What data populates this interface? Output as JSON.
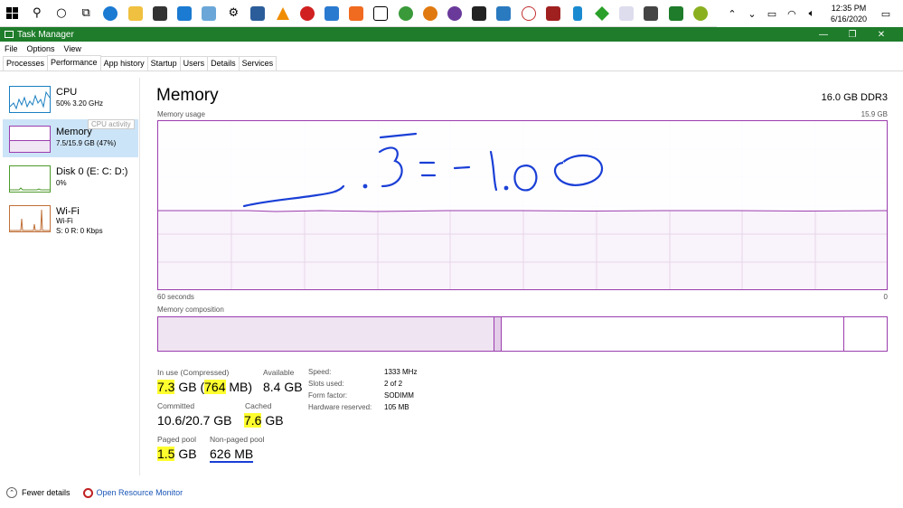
{
  "taskbar": {
    "icons": [
      "windows-start-icon",
      "search-icon",
      "cortana-icon",
      "task-view-icon",
      "edge-icon",
      "folder-icon",
      "store-icon",
      "mail-icon",
      "app-icon",
      "settings-icon",
      "photos-icon",
      "vlc-icon",
      "record-icon",
      "vscode-icon",
      "app-icon-2",
      "7zip-icon",
      "globe-icon",
      "app-icon-3",
      "app-icon-4",
      "app-icon-5",
      "terminal-icon",
      "snip-icon",
      "app-icon-6",
      "phone-icon",
      "app-icon-7",
      "app-icon-8",
      "calculator-icon",
      "app-icon-9",
      "app-icon-10"
    ],
    "time": "12:35 PM",
    "date": "6/16/2020"
  },
  "window": {
    "title": "Task Manager",
    "minimize": "—",
    "restore": "❐",
    "close": "✕"
  },
  "menu": [
    "File",
    "Options",
    "View"
  ],
  "tabs": [
    "Processes",
    "Performance",
    "App history",
    "Startup",
    "Users",
    "Details",
    "Services"
  ],
  "sidebar": {
    "cpu": {
      "title": "CPU",
      "sub": "50%  3.20 GHz"
    },
    "memory": {
      "title": "Memory",
      "sub": "7.5/15.9 GB (47%)"
    },
    "tooltip": "CPU activity",
    "disk": {
      "title": "Disk 0 (E: C: D:)",
      "sub": "0%"
    },
    "wifi": {
      "title": "Wi-Fi",
      "sub": "Wi-Fi",
      "sub2": "S: 0  R: 0 Kbps"
    }
  },
  "main": {
    "title": "Memory",
    "spec": "16.0 GB DDR3",
    "usage_label": "Memory usage",
    "usage_max": "15.9 GB",
    "time_left": "60 seconds",
    "time_right": "0",
    "composition_label": "Memory composition",
    "annotation": ".3=-1.00"
  },
  "stats": {
    "in_use_label": "In use (Compressed)",
    "in_use_a": "7.3",
    "in_use_b": " GB (",
    "in_use_c": "764",
    "in_use_d": " MB)",
    "available_label": "Available",
    "available": "8.4 GB",
    "committed_label": "Committed",
    "committed": "10.6/20.7 GB",
    "cached_label": "Cached",
    "cached_a": "7.6",
    "cached_b": " GB",
    "paged_label": "Paged pool",
    "paged_a": "1.5",
    "paged_b": " GB",
    "nonpaged_label": "Non-paged pool",
    "nonpaged": "626 MB"
  },
  "specs": {
    "speed_label": "Speed:",
    "speed": "1333 MHz",
    "slots_label": "Slots used:",
    "slots": "2 of 2",
    "form_label": "Form factor:",
    "form": "SODIMM",
    "reserved_label": "Hardware reserved:",
    "reserved": "105 MB"
  },
  "footer": {
    "fewer": "Fewer details",
    "monitor": "Open Resource Monitor"
  },
  "colors": {
    "memory": "#9b3dae",
    "cpu": "#1a7fc1",
    "disk": "#4d9a2a",
    "wifi": "#c0713a",
    "titlebar": "#1e7c2a"
  }
}
